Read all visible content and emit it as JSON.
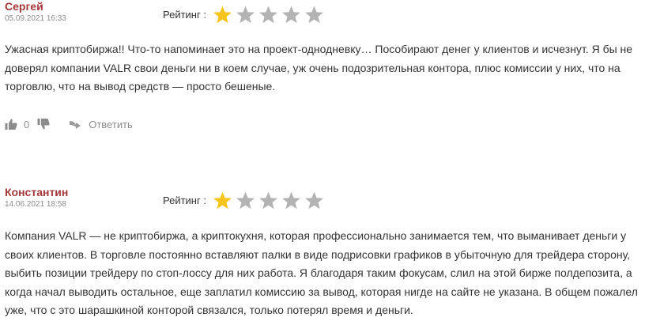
{
  "reviews": [
    {
      "author": "Сергей",
      "date": "05.09.2021 16:33",
      "rating_label": "Рейтинг :",
      "rating": 1,
      "rating_max": 5,
      "text": "Ужасная криптобиржа!! Что-то напоминает это на проект-однодневку… Пособирают денег у клиентов и исчезнут. Я бы не доверял компании VALR свои деньги ни в коем случае, уж очень подозрительная контора, плюс комиссии у них, что на торговлю, что на вывод средств — просто бешеные.",
      "likes": "0",
      "reply_label": "Ответить"
    },
    {
      "author": "Константин",
      "date": "14.06.2021 18:58",
      "rating_label": "Рейтинг :",
      "rating": 1,
      "rating_max": 5,
      "text": "Компания VALR — не криптобиржа, а криптокухня, которая профессионально занимается тем, что выманивает деньги у своих клиентов. В торговле постоянно вставляют палки в виде подрисовки графиков в убыточную для трейдера сторону, выбить позиции трейдеру по стоп-лоссу для них работа. Я благодаря таким фокусам, слил на этой бирже полдепозита, а когда начал выводить остальное, еще заплатил комиссию за вывод, которая нигде на сайте не указана. В общем пожалел уже, что с это шарашкиной конторой связался, только потерял время и деньги."
    }
  ],
  "icons": {
    "star_filled": "star-filled-icon",
    "star_empty": "star-empty-icon",
    "thumbs_up": "thumbs-up-icon",
    "thumbs_down": "thumbs-down-icon",
    "reply": "reply-arrow-icon"
  },
  "colors": {
    "author": "#a4373a",
    "star_filled": "#f5c418",
    "star_empty": "#b3b3b3",
    "muted": "#8c8c8c",
    "text": "#333333"
  }
}
